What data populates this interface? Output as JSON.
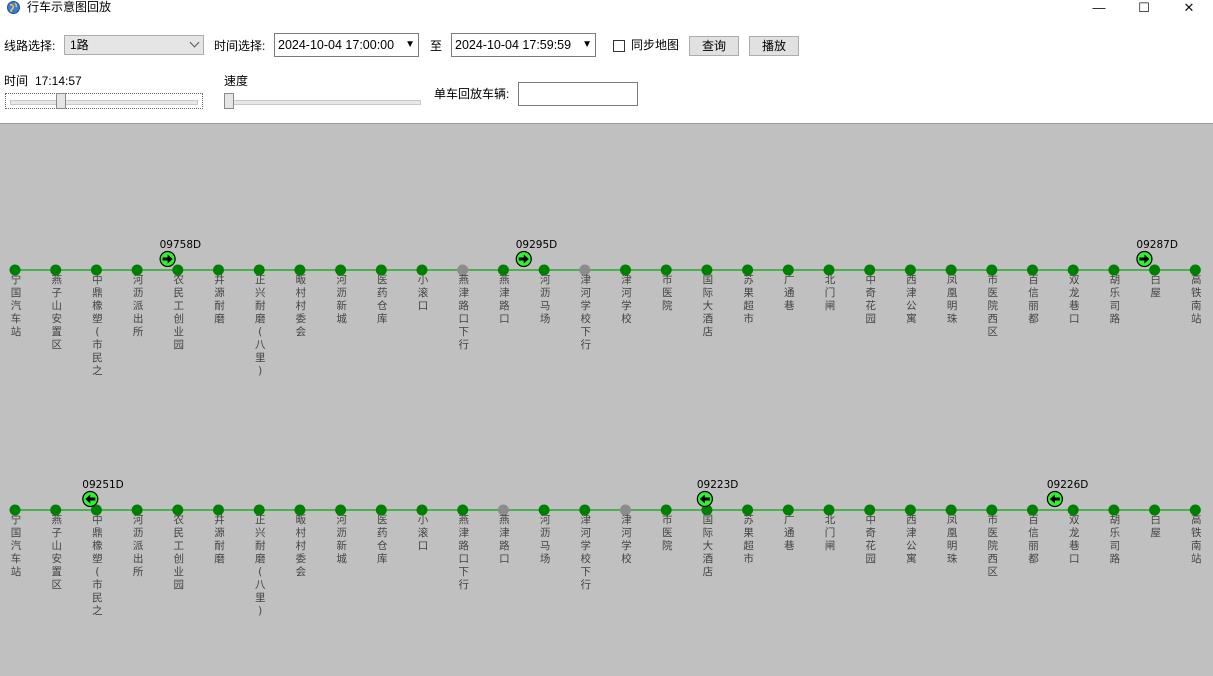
{
  "window": {
    "title": "行车示意图回放",
    "minimize_glyph": "—",
    "maximize_glyph": "☐",
    "close_glyph": "✕"
  },
  "controls": {
    "route_label": "线路选择:",
    "route_value": "1路",
    "time_label": "时间选择:",
    "start_time": "2024-10-04 17:00:00",
    "to_label": "至",
    "end_time": "2024-10-04 17:59:59",
    "dropdown_glyph": "▼",
    "sync_map_label": "同步地图",
    "sync_map_checked": false,
    "query_button": "查询",
    "play_button": "播放",
    "time_caption": "时间",
    "current_time": "17:14:57",
    "time_progress": 0.26,
    "speed_label": "速度",
    "speed_level": 0.0,
    "single_vehicle_label": "单车回放车辆:",
    "single_vehicle_value": ""
  },
  "colors": {
    "station_active": "#008000",
    "station_inactive": "#8c8c8c",
    "route_line": "#4caf50",
    "vehicle_fill": "#33ee33",
    "map_background": "#c0c0c0"
  },
  "icons": {
    "vehicle_up": "arrow-right-icon",
    "vehicle_down": "arrow-left-icon",
    "app": "globe-icon"
  },
  "routes": [
    {
      "direction": "up",
      "stations": [
        {
          "name": "宁国汽车站",
          "active": true
        },
        {
          "name": "燕子山安置区",
          "active": true
        },
        {
          "name": "中鼎橡塑(市民之",
          "active": true
        },
        {
          "name": "河沥派出所",
          "active": true
        },
        {
          "name": "农民工创业园",
          "active": true
        },
        {
          "name": "井源耐磨",
          "active": true
        },
        {
          "name": "正兴耐磨(八里)",
          "active": true
        },
        {
          "name": "畈村村委会",
          "active": true
        },
        {
          "name": "河沥新城",
          "active": true
        },
        {
          "name": "医药仓库",
          "active": true
        },
        {
          "name": "小滚口",
          "active": true
        },
        {
          "name": "燕津路口下行",
          "active": false
        },
        {
          "name": "燕津路口",
          "active": true
        },
        {
          "name": "河沥马场",
          "active": true
        },
        {
          "name": "津河学校下行",
          "active": false
        },
        {
          "name": "津河学校",
          "active": true
        },
        {
          "name": "市医院",
          "active": true
        },
        {
          "name": "国际大酒店",
          "active": true
        },
        {
          "name": "苏果超市",
          "active": true
        },
        {
          "name": "广通巷",
          "active": true
        },
        {
          "name": "北门闸",
          "active": true
        },
        {
          "name": "中奇花园",
          "active": true
        },
        {
          "name": "西津公寓",
          "active": true
        },
        {
          "name": "凤凰明珠",
          "active": true
        },
        {
          "name": "市医院西区",
          "active": true
        },
        {
          "name": "百信丽都",
          "active": true
        },
        {
          "name": "双龙巷口",
          "active": true
        },
        {
          "name": "胡乐司路",
          "active": true
        },
        {
          "name": "白屋",
          "active": true
        },
        {
          "name": "高铁南站",
          "active": true
        }
      ],
      "vehicles": [
        {
          "id": "09758D",
          "position": 3.75
        },
        {
          "id": "09295D",
          "position": 12.5
        },
        {
          "id": "09287D",
          "position": 27.75
        }
      ]
    },
    {
      "direction": "down",
      "stations": [
        {
          "name": "宁国汽车站",
          "active": true
        },
        {
          "name": "燕子山安置区",
          "active": true
        },
        {
          "name": "中鼎橡塑(市民之",
          "active": true
        },
        {
          "name": "河沥派出所",
          "active": true
        },
        {
          "name": "农民工创业园",
          "active": true
        },
        {
          "name": "井源耐磨",
          "active": true
        },
        {
          "name": "正兴耐磨(八里)",
          "active": true
        },
        {
          "name": "畈村村委会",
          "active": true
        },
        {
          "name": "河沥新城",
          "active": true
        },
        {
          "name": "医药仓库",
          "active": true
        },
        {
          "name": "小滚口",
          "active": true
        },
        {
          "name": "燕津路口下行",
          "active": true
        },
        {
          "name": "燕津路口",
          "active": false
        },
        {
          "name": "河沥马场",
          "active": true
        },
        {
          "name": "津河学校下行",
          "active": true
        },
        {
          "name": "津河学校",
          "active": false
        },
        {
          "name": "市医院",
          "active": true
        },
        {
          "name": "国际大酒店",
          "active": true
        },
        {
          "name": "苏果超市",
          "active": true
        },
        {
          "name": "广通巷",
          "active": true
        },
        {
          "name": "北门闸",
          "active": true
        },
        {
          "name": "中奇花园",
          "active": true
        },
        {
          "name": "西津公寓",
          "active": true
        },
        {
          "name": "凤凰明珠",
          "active": true
        },
        {
          "name": "市医院西区",
          "active": true
        },
        {
          "name": "百信丽都",
          "active": true
        },
        {
          "name": "双龙巷口",
          "active": true
        },
        {
          "name": "胡乐司路",
          "active": true
        },
        {
          "name": "白屋",
          "active": true
        },
        {
          "name": "高铁南站",
          "active": true
        }
      ],
      "vehicles": [
        {
          "id": "09251D",
          "position": 1.85
        },
        {
          "id": "09223D",
          "position": 16.95
        },
        {
          "id": "09226D",
          "position": 25.55
        }
      ]
    }
  ]
}
